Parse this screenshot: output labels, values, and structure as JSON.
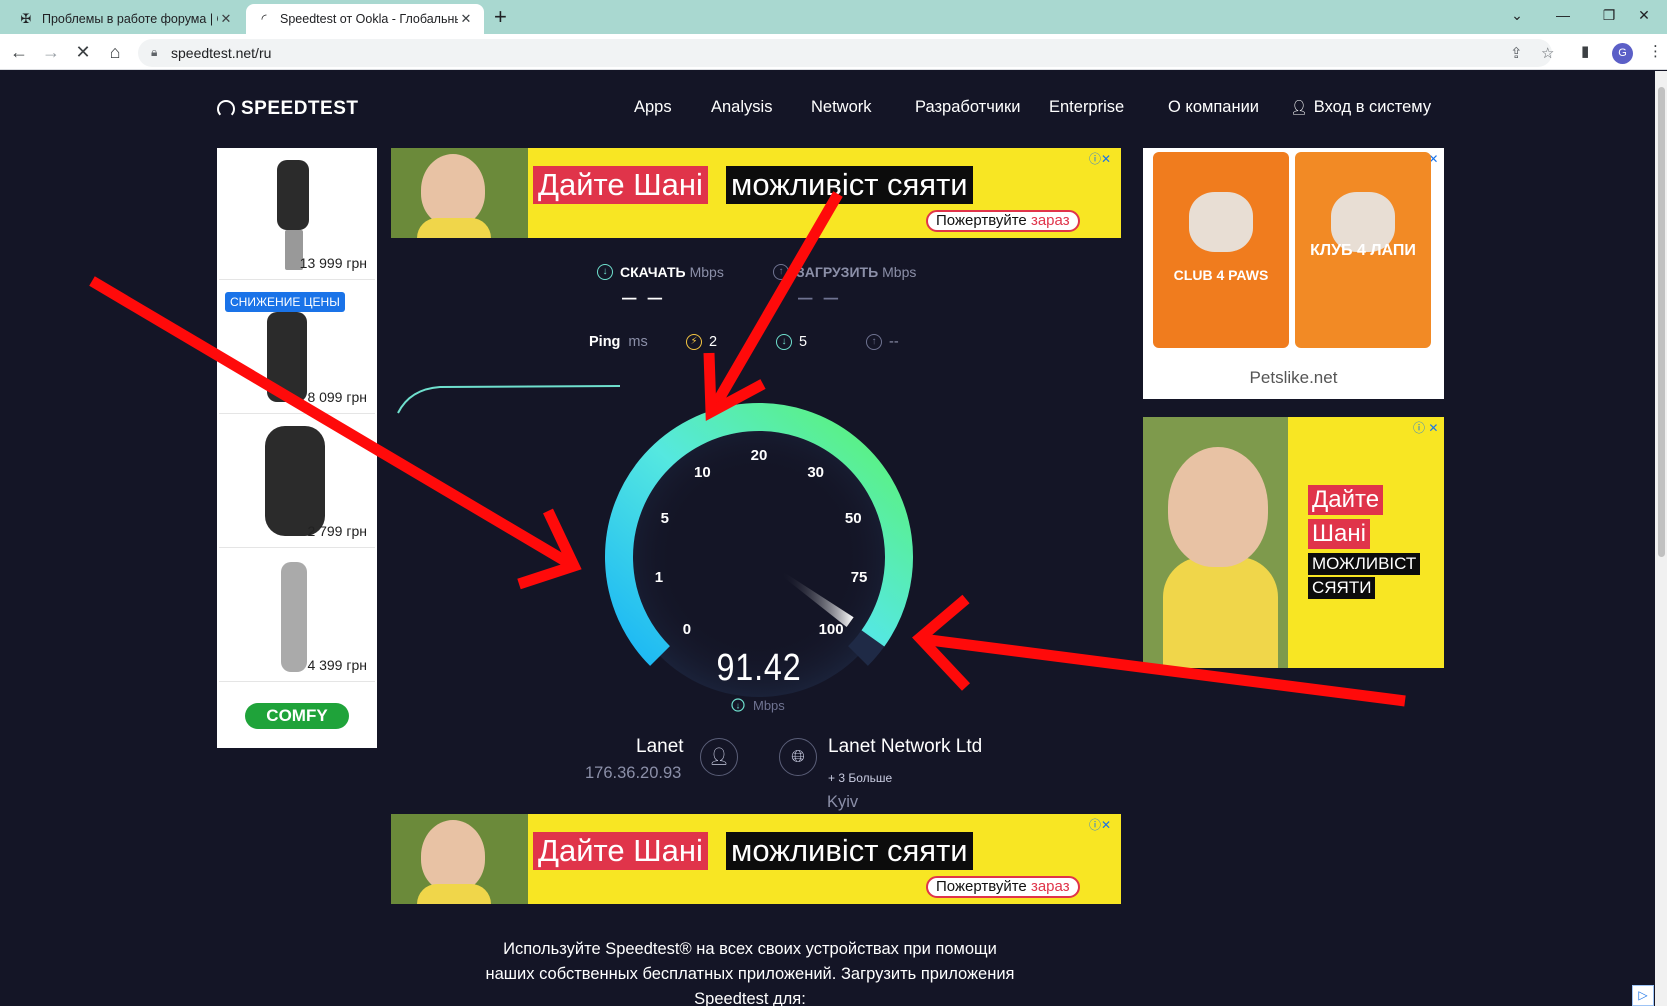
{
  "browser": {
    "tabs": [
      {
        "title": "Проблемы в работе форума | C",
        "favicon": "forum-icon"
      },
      {
        "title": "Speedtest от Ookla - Глобальны",
        "favicon": "speedtest-icon"
      }
    ],
    "url": "speedtest.net/ru",
    "avatar_letter": "G"
  },
  "site": {
    "logo": "SPEEDTEST",
    "nav": [
      "Apps",
      "Analysis",
      "Network",
      "Разработчики",
      "Enterprise",
      "О компании",
      "Вход в систему"
    ]
  },
  "ads": {
    "left_prices": [
      "13 999 грн",
      "8 099 грн",
      "2 799 грн",
      "4 399 грн"
    ],
    "left_badge": "СНИЖЕНИЕ ЦЕНЫ",
    "left_brand": "COMFY",
    "banner_red": "Дайте Шані",
    "banner_black": "можливіст сяяти",
    "banner_cta_a": "Пожертвуйте ",
    "banner_cta_b": "зараз",
    "right1_bag1": "CLUB 4 PAWS",
    "right1_bag2": "КЛУБ 4 ЛАПИ",
    "right1_site": "Petslike.net",
    "right2_l1": "Дайте",
    "right2_l2": "Шані",
    "right2_l3": "МОЖЛИВІСТ",
    "right2_l4": "СЯЯТИ"
  },
  "test": {
    "download_label": "СКАЧАТЬ",
    "upload_label": "ЗАГРУЗИТЬ",
    "unit": "Mbps",
    "download_value": "– –",
    "upload_value": "– –",
    "ping_label": "Ping",
    "ping_unit": "ms",
    "ping_idle": "2",
    "ping_down": "5",
    "ping_up": "--",
    "gauge_ticks": [
      "0",
      "1",
      "5",
      "10",
      "20",
      "30",
      "50",
      "75",
      "100"
    ],
    "gauge_value": "91.42",
    "gauge_unit": "Mbps",
    "gauge_fraction": 0.965
  },
  "server": {
    "isp": "Lanet",
    "ip": "176.36.20.93",
    "host": "Lanet Network Ltd",
    "more": "+ 3 Больше",
    "city": "Kyiv"
  },
  "footer": {
    "line1": "Используйте Speedtest® на всех своих устройствах при помощи",
    "line2": "наших собственных бесплатных приложений. Загрузить приложения",
    "line3": "Speedtest для:"
  },
  "colors": {
    "background": "#141526",
    "gauge_start": "#1ab6f5",
    "gauge_end": "#5cf36e",
    "annotation_arrow": "#ff0a0a"
  }
}
